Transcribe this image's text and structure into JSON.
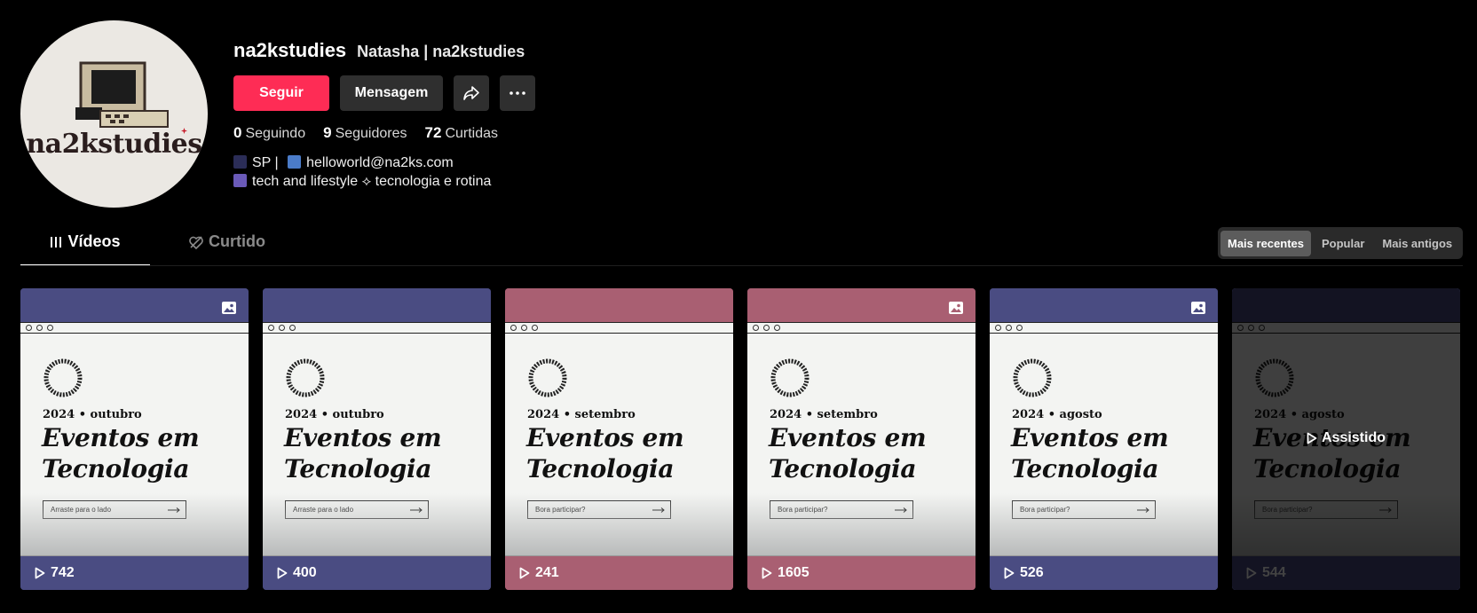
{
  "profile": {
    "avatar_brand": "na2kstudies",
    "username": "na2kstudies",
    "nickname": "Natasha | na2kstudies",
    "follow_label": "Seguir",
    "message_label": "Mensagem",
    "stats": [
      {
        "value": "0",
        "label": "Seguindo"
      },
      {
        "value": "9",
        "label": "Seguidores"
      },
      {
        "value": "72",
        "label": "Curtidas"
      }
    ],
    "bio_line1_part1": "SP |",
    "bio_line1_part2": "helloworld@na2ks.com",
    "bio_line2": "tech and lifestyle ⟡ tecnologia e rotina"
  },
  "tabs": {
    "videos": "Vídeos",
    "liked": "Curtido"
  },
  "sort": {
    "recent": "Mais recentes",
    "popular": "Popular",
    "oldest": "Mais antigos",
    "selected": "Mais recentes"
  },
  "videos": [
    {
      "date": "2024 • outubro",
      "title_line1": "Eventos em",
      "title_line2": "Tecnologia",
      "cta": "Arraste para o lado",
      "views": "742",
      "theme": "#4a4c82",
      "photo_badge": true
    },
    {
      "date": "2024 • outubro",
      "title_line1": "Eventos em",
      "title_line2": "Tecnologia",
      "cta": "Arraste para o lado",
      "views": "400",
      "theme": "#4a4c82",
      "photo_badge": false
    },
    {
      "date": "2024 • setembro",
      "title_line1": "Eventos em",
      "title_line2": "Tecnologia",
      "cta": "Bora participar?",
      "views": "241",
      "theme": "#a95f72",
      "photo_badge": false
    },
    {
      "date": "2024 • setembro",
      "title_line1": "Eventos em",
      "title_line2": "Tecnologia",
      "cta": "Bora participar?",
      "views": "1605",
      "theme": "#a95f72",
      "photo_badge": true
    },
    {
      "date": "2024 • agosto",
      "title_line1": "Eventos em",
      "title_line2": "Tecnologia",
      "cta": "Bora participar?",
      "views": "526",
      "theme": "#4a4c82",
      "photo_badge": true
    },
    {
      "date": "2024 • agosto",
      "title_line1": "Eventos em",
      "title_line2": "Tecnologia",
      "cta": "Bora participar?",
      "views": "544",
      "theme": "#4a4c82",
      "photo_badge": false,
      "watched": "Assistido"
    }
  ],
  "colors": {
    "accent": "#fe2c55",
    "button_dark": "#2f2f2f",
    "indigo_theme": "#4a4c82",
    "rose_theme": "#a95f72"
  }
}
